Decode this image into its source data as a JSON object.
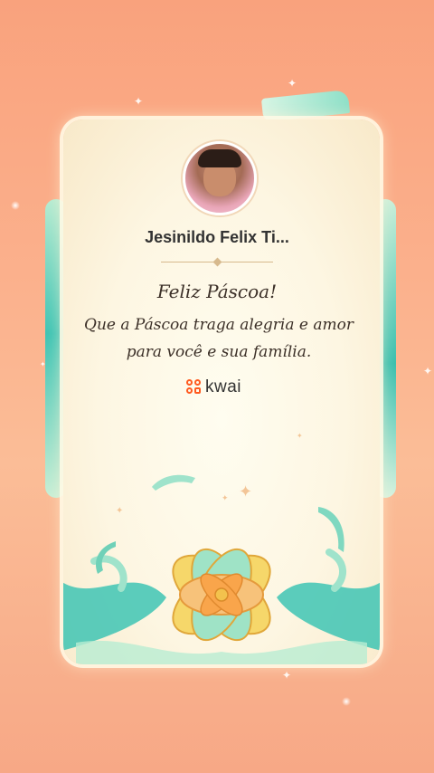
{
  "card": {
    "sender_name": "Jesinildo Felix Ti...",
    "greeting_title": "Feliz Páscoa!",
    "greeting_message": "Que a Páscoa traga alegria e amor para você e sua família.",
    "brand_name": "kwai"
  },
  "colors": {
    "background": "#f9a27d",
    "card": "#fdf6e2",
    "ribbon": "#3ec4b4",
    "brand": "#ff5a1f"
  },
  "icons": {
    "avatar": "profile-photo",
    "brand": "kwai-logo-icon"
  }
}
